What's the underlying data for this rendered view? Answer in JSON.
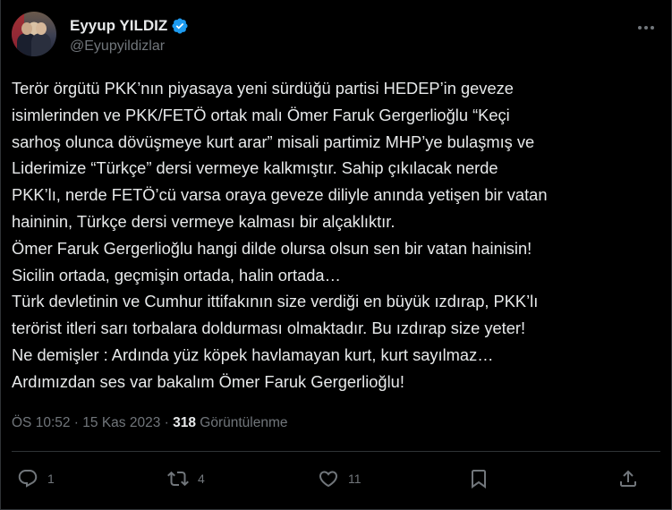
{
  "author": {
    "name": "Eyyup YILDIZ",
    "handle": "@Eyupyildizlar",
    "verified": true
  },
  "tweet": {
    "lines": [
      "Terör örgütü PKK’nın piyasaya yeni sürdüğü partisi HEDEP’in geveze",
      "isimlerinden ve PKK/FETÖ ortak malı Ömer Faruk Gergerlioğlu “Keçi",
      "sarhoş olunca dövüşmeye kurt arar” misali partimiz MHP’ye bulaşmış ve",
      "Liderimize “Türkçe” dersi vermeye kalkmıştır. Sahip çıkılacak nerde",
      "PKK’lı, nerde FETÖ’cü varsa oraya geveze diliyle anında yetişen bir vatan",
      "haininin, Türkçe dersi vermeye kalması bir alçaklıktır.",
      "Ömer Faruk Gergerlioğlu hangi dilde olursa olsun sen bir vatan hainisin!",
      "Sicilin ortada, geçmişin ortada, halin ortada…",
      "Türk devletinin ve Cumhur ittifakının size verdiği en büyük ızdırap, PKK’lı",
      "terörist itleri sarı torbalara doldurması olmaktadır. Bu ızdırap size yeter!",
      "Ne demişler : Ardında yüz köpek havlamayan kurt, kurt sayılmaz…",
      "Ardımızdan ses var bakalım Ömer Faruk Gergerlioğlu!"
    ]
  },
  "meta": {
    "time": "ÖS 10:52",
    "sep1": " · ",
    "date": "15 Kas 2023",
    "sep2": " · ",
    "views": "318",
    "views_label": " Görüntülenme"
  },
  "actions": {
    "replies": "1",
    "reposts": "4",
    "likes": "11"
  },
  "colors": {
    "background": "#000000",
    "text": "#e7e9ea",
    "secondary": "#71767b",
    "verified": "#1d9bf0"
  }
}
